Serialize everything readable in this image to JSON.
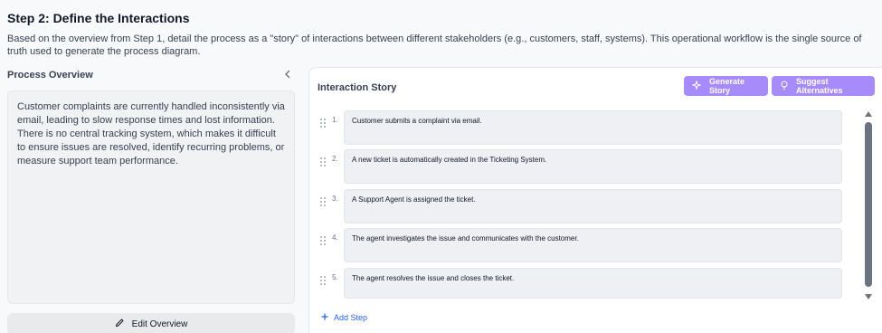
{
  "header": {
    "title": "Step 2: Define the Interactions",
    "description": "Based on the overview from Step 1, detail the process as a \"story\" of interactions between different stakeholders (e.g., customers, staff, systems). This operational workflow is the single source of truth used to generate the process diagram."
  },
  "overview": {
    "title": "Process Overview",
    "collapse_icon": "chevron-left-icon",
    "text": "Customer complaints are currently handled inconsistently via email, leading to slow response times and lost information. There is no central tracking system, which makes it difficult to ensure issues are resolved, identify recurring problems, or measure support team performance.",
    "edit_label": "Edit Overview",
    "edit_icon": "pencil-icon"
  },
  "story": {
    "title": "Interaction Story",
    "generate_label": "Generate Story",
    "suggest_label": "Suggest Alternatives",
    "steps": [
      {
        "num": "1.",
        "text": "Customer submits a complaint via email."
      },
      {
        "num": "2.",
        "text": "A new ticket is automatically created in the Ticketing System."
      },
      {
        "num": "3.",
        "text": "A Support Agent is assigned the ticket."
      },
      {
        "num": "4.",
        "text": "The agent investigates the issue and communicates with the customer."
      },
      {
        "num": "5.",
        "text": "The agent resolves the issue and closes the ticket."
      }
    ],
    "add_step_label": "Add Step"
  },
  "colors": {
    "accent": "#a78bfa",
    "link": "#2563eb"
  }
}
